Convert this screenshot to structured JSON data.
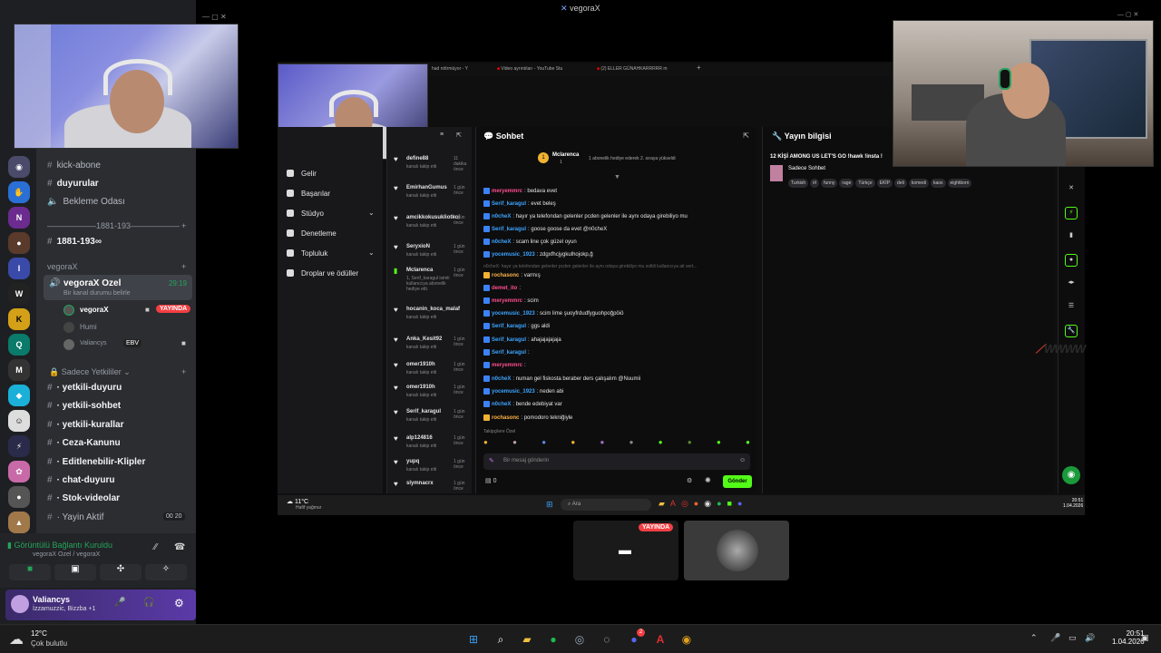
{
  "stream_title": "vegoraX",
  "discord": {
    "channels_top": [
      {
        "label": "kick-abone",
        "icon": "hash"
      },
      {
        "label": "duyurular",
        "icon": "megaphone"
      },
      {
        "label": "Bekleme Odası",
        "icon": "speaker"
      }
    ],
    "divider": "1881-193",
    "channel_1881": "1881-193∞",
    "category_vegorax": "vegoraX",
    "voice_channel": {
      "name": "vegoraX Ozel",
      "time": "29:19",
      "status": "Bir kanal durumu belirle"
    },
    "voice_users": [
      {
        "name": "vegoraX",
        "badge": "YAYINDA"
      },
      {
        "name": "Humi",
        "badge": ""
      },
      {
        "name": "Valiancys",
        "badge": "EBV"
      }
    ],
    "category_sadece": "Sadece Yetkililer",
    "channels_bottom": [
      "· yetkili-duyuru",
      "· yetkili-sohbet",
      "· yetkili-kurallar",
      "· Ceza-Kanunu",
      "· Editlenebilir-Klipler",
      "· chat-duyuru",
      "· Stok-videolar",
      "· Yayin Aktif"
    ],
    "yayin_aktif_counts": [
      "00",
      "20"
    ],
    "voice_connected": "Görüntülü Bağlantı Kuruldu",
    "voice_sub": "vegoraX Ozel / vegoraX",
    "user": {
      "name": "Valiancys",
      "status": "İzzamuzzic, Bizzba +1"
    }
  },
  "browser": {
    "tabs": [
      "had nötrmüyor - Y",
      "Video ayrıntıları - YouTube Stu",
      "(2) ELLER GÜNAHKARRRRR m"
    ],
    "kick_menu": [
      "Gelir",
      "Başarılar",
      "Stüdyo",
      "Denetleme",
      "Topluluk",
      "Droplar ve ödüller"
    ],
    "followers": [
      {
        "name": "define88",
        "sub": "kanalı takip etti",
        "time": "11 dakika önce"
      },
      {
        "name": "EmirhanGumus",
        "sub": "kanalı takip etti",
        "time": "1 gün önce"
      },
      {
        "name": "amcikkokusukliotkoi",
        "sub": "kanalı takip etti",
        "time": "1 gün önce"
      },
      {
        "name": "SeryxioN",
        "sub": "kanalı takip etti",
        "time": "1 gün önce"
      },
      {
        "name": "Mclarenca",
        "sub": "1, Serif_karagul isimli kullanıcıya abonelik hediye etti.",
        "time": "1 gün önce"
      },
      {
        "name": "hocanin_koca_malaf",
        "sub": "kanalı takip etti",
        "time": ""
      },
      {
        "name": "Anka_Kesit92",
        "sub": "kanalı takip etti",
        "time": "1 gün önce"
      },
      {
        "name": "omer1910h",
        "sub": "kanalı takip etti",
        "time": "1 gün önce"
      },
      {
        "name": "omer1910h",
        "sub": "kanalı takip etti",
        "time": "1 gün önce"
      },
      {
        "name": "Serif_karagul",
        "sub": "kanalı takip etti",
        "time": "1 gün önce"
      },
      {
        "name": "alp124816",
        "sub": "kanalı takip etti",
        "time": "1 gün önce"
      },
      {
        "name": "yupq",
        "sub": "kanalı takip etti",
        "time": "1 gün önce"
      },
      {
        "name": "slymnacrx",
        "sub": "",
        "time": "1 gün önce"
      }
    ],
    "chat_title": "Sohbet",
    "gift_banner": {
      "name": "Mclarenca",
      "count": "1",
      "text": "1 abonelik hediye ederek 2. sıraya yükseldi"
    },
    "messages": [
      {
        "user": "meryemmrc",
        "text": "bedava evet",
        "color": "#ff4d8d"
      },
      {
        "user": "Serif_karagul",
        "text": "evet beleş",
        "color": "#3da5ff"
      },
      {
        "user": "n0cheX",
        "text": "hayır ya telefondan gelenler pcden gelenler ile aynı odaya girebiliyo mu",
        "color": "#3da5ff"
      },
      {
        "user": "Serif_karagul",
        "text": "goose goose da evet @n0cheX",
        "color": "#3da5ff"
      },
      {
        "user": "n0cheX",
        "text": "scam line çok güzel oyun",
        "color": "#3da5ff"
      },
      {
        "user": "yocemusic_1923",
        "text": "zdgxfhcjygkulhojokp,ğ",
        "color": "#3da5ff"
      },
      {
        "user": "rochasonc",
        "text": "varmış",
        "color": "#ffb347"
      },
      {
        "user": "demet_ito",
        "text": "",
        "color": "#ff4d8d"
      },
      {
        "user": "meryemmrc",
        "text": "scim",
        "color": "#ff4d8d"
      },
      {
        "user": "yocemusic_1923",
        "text": "scim lime şuoyfrdudfyguohpoğpöiö",
        "color": "#3da5ff"
      },
      {
        "user": "Serif_karagul",
        "text": "ggs aldi",
        "color": "#3da5ff"
      },
      {
        "user": "Serif_karagul",
        "text": "ahajajajajaja",
        "color": "#3da5ff"
      },
      {
        "user": "Serif_karagul",
        "text": "",
        "color": "#3da5ff"
      },
      {
        "user": "meryemmrc",
        "text": "",
        "color": "#ff4d8d"
      },
      {
        "user": "n0cheX",
        "text": "numan gel fiskosta beraber ders çalışalım @Nuumii",
        "color": "#3da5ff"
      },
      {
        "user": "yocemusic_1923",
        "text": "neden abi",
        "color": "#3da5ff"
      },
      {
        "user": "n0cheX",
        "text": "bende edebiyat var",
        "color": "#3da5ff"
      },
      {
        "user": "rochasonc",
        "text": "pomodoro tekniğiyle",
        "color": "#ffb347"
      }
    ],
    "reply_preview": "n0cheX: hayır ya telefondan gelenler pcden gelenler ile aynı odaya girebiliyo mu soltili kullanıcıya ait vert...",
    "emote_bar_label": "Takipçilere Özel",
    "chat_placeholder": "Bir mesaj gönderin",
    "chat_count": "0",
    "send_label": "Gönder",
    "info_title": "Yayın bilgisi",
    "stream_name": "12 KİŞİ AMONG US LET'S GO !hawk !insta !",
    "category": "Sadece Sohbet",
    "tags": [
      "Turkish",
      "irl",
      "funny",
      "rage",
      "Türkçe",
      "EKİP",
      "deli",
      "komedi",
      "kaos",
      "eightborn"
    ],
    "inner_weather": {
      "temp": "11°C",
      "desc": "Hafif yağmur"
    },
    "inner_search": "Ara",
    "inner_time": "20:51",
    "inner_date": "1.04.2026"
  },
  "call_tiles": {
    "live_badge": "YAYINDA"
  },
  "taskbar": {
    "weather_temp": "12°C",
    "weather_desc": "Çok bulutlu",
    "time": "20:51",
    "date": "1.04.2026",
    "discord_badge": "2"
  },
  "colors": {
    "kick_green": "#53fc18",
    "discord_live": "#f23f43",
    "blurple": "#5865f2"
  }
}
